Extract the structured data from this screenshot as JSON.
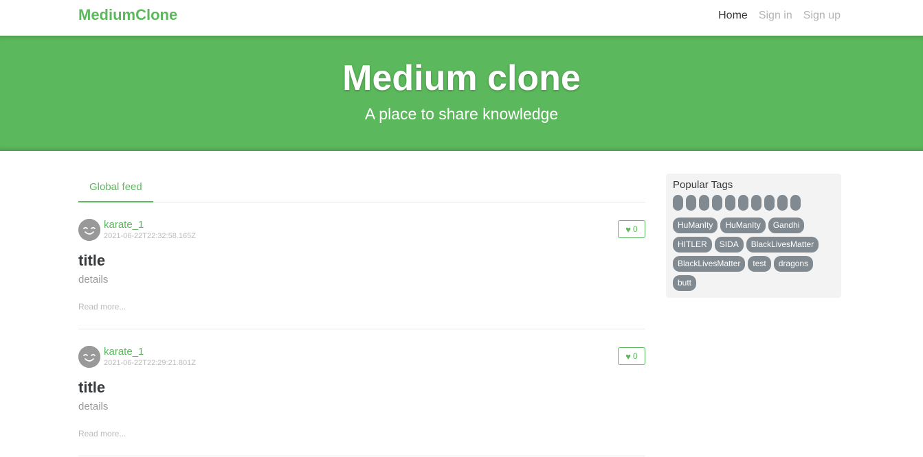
{
  "navbar": {
    "brand": "MediumClone",
    "links": [
      {
        "label": "Home",
        "active": true
      },
      {
        "label": "Sign in",
        "active": false
      },
      {
        "label": "Sign up",
        "active": false
      }
    ]
  },
  "banner": {
    "title": "Medium clone",
    "subtitle": "A place to share knowledge"
  },
  "feed": {
    "tab_label": "Global feed",
    "articles": [
      {
        "author": "karate_1",
        "date": "2021-06-22T22:32:58.165Z",
        "likes": "0",
        "title": "title",
        "description": "details",
        "read_more": "Read more..."
      },
      {
        "author": "karate_1",
        "date": "2021-06-22T22:29:21.801Z",
        "likes": "0",
        "title": "title",
        "description": "details",
        "read_more": "Read more..."
      }
    ]
  },
  "sidebar": {
    "heading": "Popular Tags",
    "empty_tag_count": 10,
    "tags": [
      "HuManIty",
      "HuManIty",
      "Gandhi",
      "HITLER",
      "SIDA",
      "BlackLivesMatter",
      "BlackLivesMatter",
      "test",
      "dragons",
      "butt"
    ]
  },
  "colors": {
    "accent": "#5cb85c",
    "tag_bg": "#818a91",
    "sidebar_bg": "#f3f3f3"
  }
}
